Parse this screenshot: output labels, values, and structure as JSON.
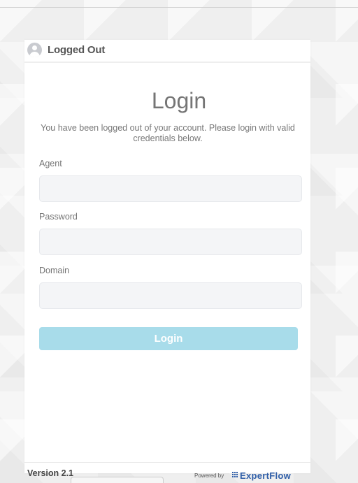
{
  "header": {
    "title": "Logged Out",
    "avatar_icon": "user-avatar-icon"
  },
  "login_form": {
    "title": "Login",
    "message": "You have been logged out of your account. Please login with valid credentials below.",
    "fields": {
      "agent": {
        "label": "Agent",
        "value": "",
        "placeholder": ""
      },
      "password": {
        "label": "Password",
        "value": "",
        "placeholder": ""
      },
      "domain": {
        "label": "Domain",
        "value": "",
        "placeholder": ""
      }
    },
    "submit_label": "Login",
    "submit_color": "#a8dcea"
  },
  "footer": {
    "version": "Version 2.1",
    "powered_by": "Powered by",
    "brand": "ExpertFlow",
    "brand_color": "#2f5ea8"
  }
}
